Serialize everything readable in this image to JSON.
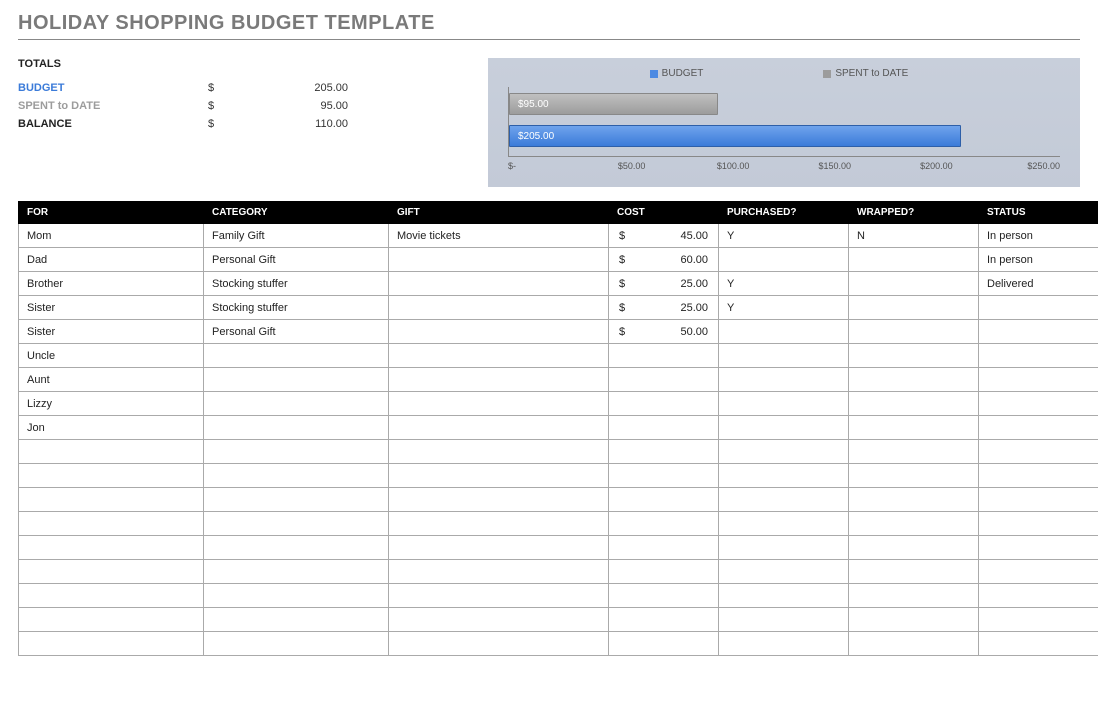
{
  "title": "HOLIDAY SHOPPING BUDGET TEMPLATE",
  "totals": {
    "heading": "TOTALS",
    "budget": {
      "label": "BUDGET",
      "currency": "$",
      "value": "205.00"
    },
    "spent": {
      "label": "SPENT to DATE",
      "currency": "$",
      "value": "95.00"
    },
    "balance": {
      "label": "BALANCE",
      "currency": "$",
      "value": "110.00"
    }
  },
  "chart_data": {
    "type": "bar",
    "orientation": "horizontal",
    "legend": {
      "budget": "BUDGET",
      "spent": "SPENT to DATE"
    },
    "series": [
      {
        "name": "SPENT to DATE",
        "value": 95.0,
        "label": "$95.00"
      },
      {
        "name": "BUDGET",
        "value": 205.0,
        "label": "$205.00"
      }
    ],
    "xmax": 250,
    "ticks": [
      "$-",
      "$50.00",
      "$100.00",
      "$150.00",
      "$200.00",
      "$250.00"
    ]
  },
  "table": {
    "headers": {
      "for": "FOR",
      "category": "CATEGORY",
      "gift": "GIFT",
      "cost": "COST",
      "purchased": "PURCHASED?",
      "wrapped": "WRAPPED?",
      "status": "STATUS"
    },
    "currency": "$",
    "rows": [
      {
        "for": "Mom",
        "category": "Family Gift",
        "gift": "Movie tickets",
        "cost": "45.00",
        "purchased": "Y",
        "wrapped": "N",
        "status": "In person"
      },
      {
        "for": "Dad",
        "category": "Personal Gift",
        "gift": "",
        "cost": "60.00",
        "purchased": "",
        "wrapped": "",
        "status": "In person"
      },
      {
        "for": "Brother",
        "category": "Stocking stuffer",
        "gift": "",
        "cost": "25.00",
        "purchased": "Y",
        "wrapped": "",
        "status": "Delivered"
      },
      {
        "for": "Sister",
        "category": "Stocking stuffer",
        "gift": "",
        "cost": "25.00",
        "purchased": "Y",
        "wrapped": "",
        "status": ""
      },
      {
        "for": "Sister",
        "category": "Personal Gift",
        "gift": "",
        "cost": "50.00",
        "purchased": "",
        "wrapped": "",
        "status": ""
      },
      {
        "for": "Uncle",
        "category": "",
        "gift": "",
        "cost": "",
        "purchased": "",
        "wrapped": "",
        "status": ""
      },
      {
        "for": "Aunt",
        "category": "",
        "gift": "",
        "cost": "",
        "purchased": "",
        "wrapped": "",
        "status": ""
      },
      {
        "for": "Lizzy",
        "category": "",
        "gift": "",
        "cost": "",
        "purchased": "",
        "wrapped": "",
        "status": ""
      },
      {
        "for": "Jon",
        "category": "",
        "gift": "",
        "cost": "",
        "purchased": "",
        "wrapped": "",
        "status": ""
      },
      {
        "for": "",
        "category": "",
        "gift": "",
        "cost": "",
        "purchased": "",
        "wrapped": "",
        "status": ""
      },
      {
        "for": "",
        "category": "",
        "gift": "",
        "cost": "",
        "purchased": "",
        "wrapped": "",
        "status": ""
      },
      {
        "for": "",
        "category": "",
        "gift": "",
        "cost": "",
        "purchased": "",
        "wrapped": "",
        "status": ""
      },
      {
        "for": "",
        "category": "",
        "gift": "",
        "cost": "",
        "purchased": "",
        "wrapped": "",
        "status": ""
      },
      {
        "for": "",
        "category": "",
        "gift": "",
        "cost": "",
        "purchased": "",
        "wrapped": "",
        "status": ""
      },
      {
        "for": "",
        "category": "",
        "gift": "",
        "cost": "",
        "purchased": "",
        "wrapped": "",
        "status": ""
      },
      {
        "for": "",
        "category": "",
        "gift": "",
        "cost": "",
        "purchased": "",
        "wrapped": "",
        "status": ""
      },
      {
        "for": "",
        "category": "",
        "gift": "",
        "cost": "",
        "purchased": "",
        "wrapped": "",
        "status": ""
      },
      {
        "for": "",
        "category": "",
        "gift": "",
        "cost": "",
        "purchased": "",
        "wrapped": "",
        "status": ""
      }
    ]
  }
}
